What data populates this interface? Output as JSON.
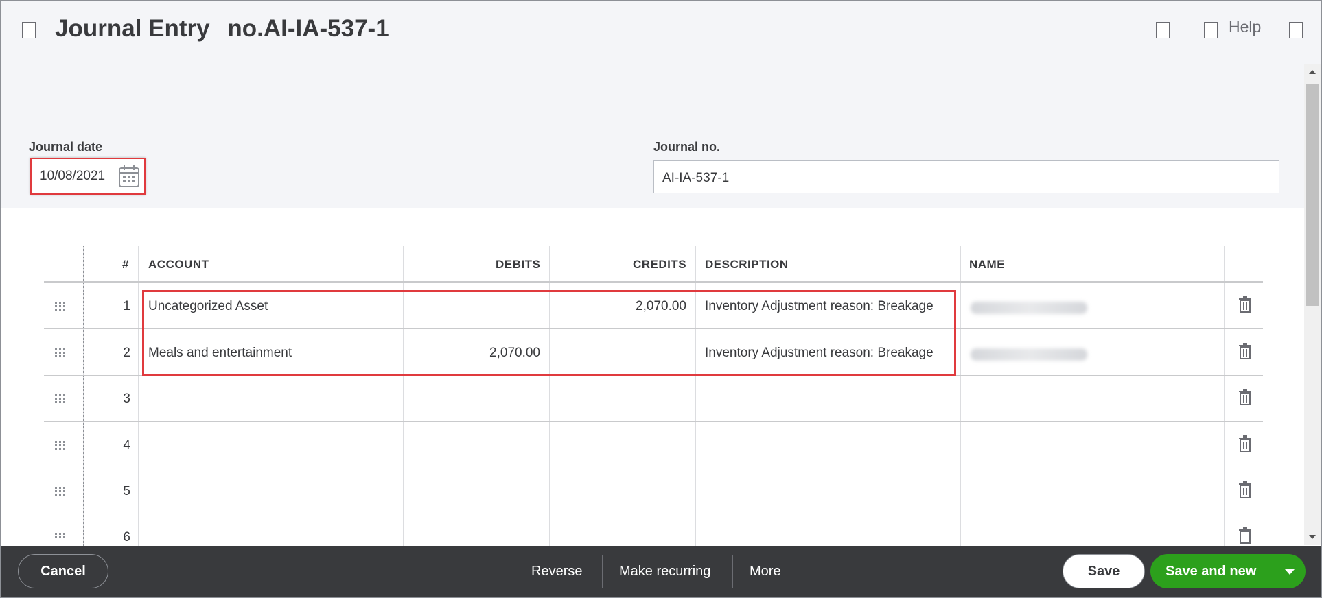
{
  "header": {
    "title": "Journal Entry",
    "number": "no.AI-IA-537-1",
    "help_label": "Help"
  },
  "form": {
    "journal_date_label": "Journal date",
    "journal_date_value": "10/08/2021",
    "journal_no_label": "Journal no.",
    "journal_no_value": "AI-IA-537-1"
  },
  "table": {
    "columns": [
      "#",
      "ACCOUNT",
      "DEBITS",
      "CREDITS",
      "DESCRIPTION",
      "NAME"
    ],
    "rows": [
      {
        "num": "1",
        "account": "Uncategorized Asset",
        "debits": "",
        "credits": "2,070.00",
        "description": "Inventory Adjustment reason: Breakage"
      },
      {
        "num": "2",
        "account": "Meals and entertainment",
        "debits": "2,070.00",
        "credits": "",
        "description": "Inventory Adjustment reason: Breakage"
      },
      {
        "num": "3",
        "account": "",
        "debits": "",
        "credits": "",
        "description": ""
      },
      {
        "num": "4",
        "account": "",
        "debits": "",
        "credits": "",
        "description": ""
      },
      {
        "num": "5",
        "account": "",
        "debits": "",
        "credits": "",
        "description": ""
      },
      {
        "num": "6",
        "account": "",
        "debits": "",
        "credits": "",
        "description": ""
      }
    ]
  },
  "footer": {
    "cancel": "Cancel",
    "reverse": "Reverse",
    "make_recurring": "Make recurring",
    "more": "More",
    "save": "Save",
    "save_and_new": "Save and new"
  },
  "colors": {
    "accent_green": "#2ca01c",
    "highlight_red": "#e03a3e",
    "footer_bg": "#393a3d"
  }
}
